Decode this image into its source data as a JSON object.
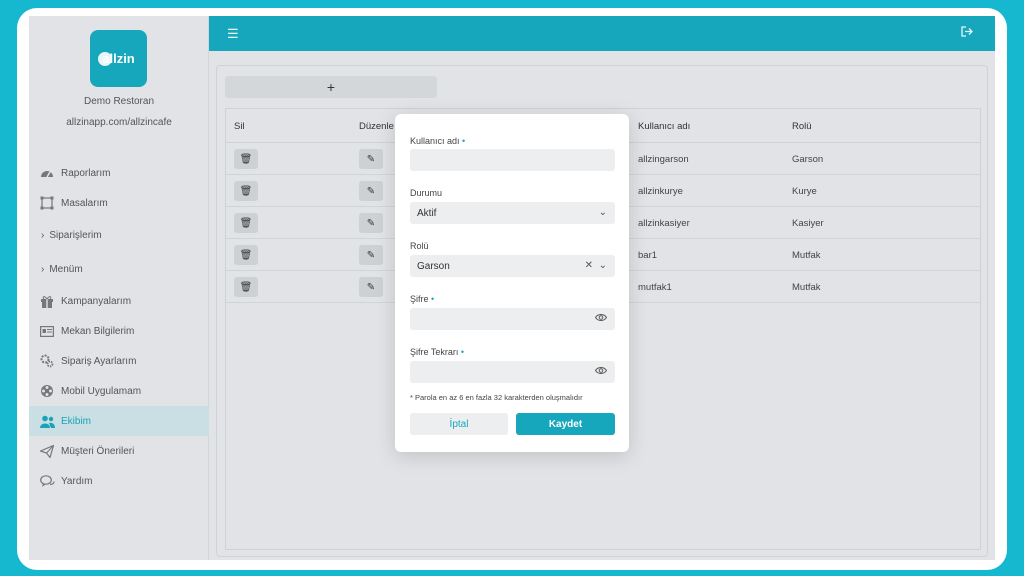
{
  "sidebar": {
    "logo_text": "allzin",
    "restaurant_name": "Demo Restoran",
    "restaurant_url": "allzinapp.com/allzincafe",
    "items": [
      {
        "label": "Raporlarım",
        "icon": "speedometer-icon"
      },
      {
        "label": "Masalarım",
        "icon": "table-frame-icon"
      },
      {
        "label": "Siparişlerim",
        "icon": "chevron-right-icon"
      },
      {
        "label": "Menüm",
        "icon": "chevron-right-icon"
      },
      {
        "label": "Kampanyalarım",
        "icon": "gift-icon"
      },
      {
        "label": "Mekan Bilgilerim",
        "icon": "id-card-icon"
      },
      {
        "label": "Sipariş Ayarlarım",
        "icon": "gears-icon"
      },
      {
        "label": "Mobil Uygulamam",
        "icon": "film-reel-icon"
      },
      {
        "label": "Ekibim",
        "icon": "team-icon"
      },
      {
        "label": "Müşteri Önerileri",
        "icon": "paper-plane-icon"
      },
      {
        "label": "Yardım",
        "icon": "chat-icon"
      }
    ],
    "active_index": 8
  },
  "topbar": {
    "menu_icon": "hamburger-icon",
    "logout_icon": "logout-icon"
  },
  "content": {
    "add_label": "+",
    "columns": [
      "Sil",
      "Düzenle",
      "Kullanıcı adı",
      "Rolü"
    ],
    "rows": [
      {
        "username": "allzingarson",
        "role": "Garson"
      },
      {
        "username": "allzinkurye",
        "role": "Kurye"
      },
      {
        "username": "allzinkasiyer",
        "role": "Kasiyer"
      },
      {
        "username": "bar1",
        "role": "Mutfak"
      },
      {
        "username": "mutfak1",
        "role": "Mutfak"
      }
    ]
  },
  "modal": {
    "username_label": "Kullanıcı adı",
    "username_value": "",
    "status_label": "Durumu",
    "status_value": "Aktif",
    "role_label": "Rolü",
    "role_value": "Garson",
    "password_label": "Şifre",
    "password_value": "",
    "password_repeat_label": "Şifre Tekrarı",
    "password_repeat_value": "",
    "required_mark": "•",
    "note": "* Parola en az 6 en fazla 32 karakterden oluşmalıdır",
    "cancel_label": "İptal",
    "save_label": "Kaydet"
  },
  "colors": {
    "accent": "#17a7bd",
    "frame": "#16b8cf"
  }
}
